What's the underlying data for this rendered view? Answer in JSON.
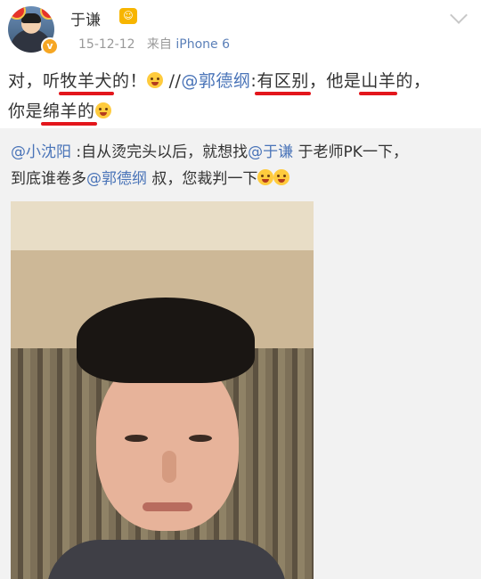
{
  "post": {
    "user_name": "于谦",
    "time": "15-12-12",
    "source_prefix": "来自",
    "source": "iPhone 6",
    "text": {
      "p1": "对，听",
      "u1": "牧羊犬",
      "p2": "的！",
      "sep": " //",
      "mention": "@郭德纲",
      "colon": ":",
      "u2": "有区别",
      "p3": "，他是",
      "u3": "山羊",
      "p4": "的，",
      "p5": "你是",
      "u4": "绵羊的"
    }
  },
  "repost": {
    "mention1": "@小沈阳",
    "t1": " :自从烫完头以后，就想找",
    "mention2": "@于谦",
    "t2": " 于老师PK一下，",
    "t3": "到底谁卷多",
    "mention3": "@郭德纲",
    "t4": " 叔，您裁判一下"
  }
}
